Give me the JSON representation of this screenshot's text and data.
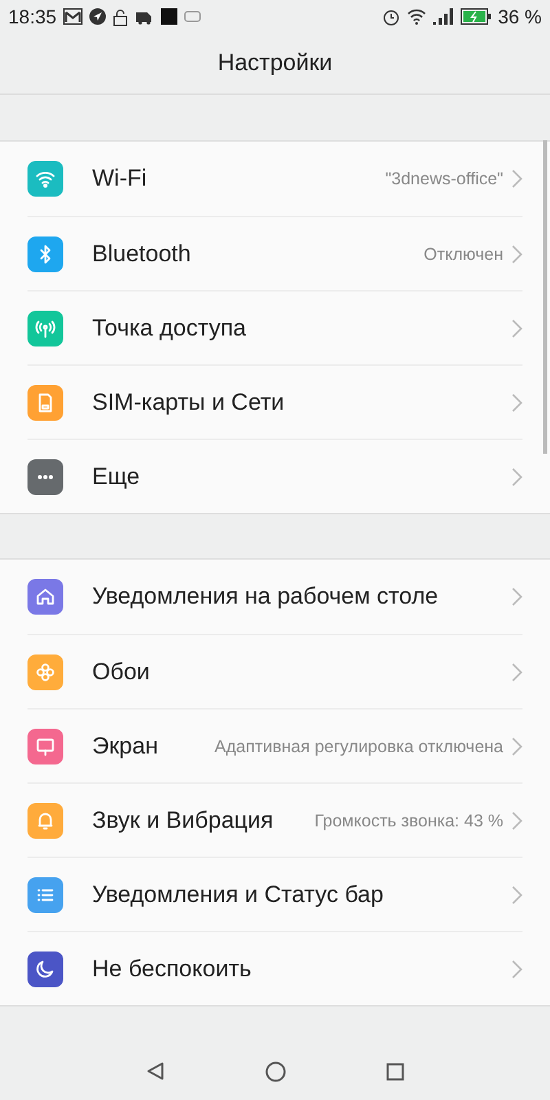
{
  "status_bar": {
    "time": "18:35",
    "battery": "36 %"
  },
  "header": {
    "title": "Настройки"
  },
  "groups": [
    {
      "items": [
        {
          "label": "Wi-Fi",
          "value": "\"3dnews-office\"",
          "color": "#1bbcc0"
        },
        {
          "label": "Bluetooth",
          "value": "Отключен",
          "color": "#1ea7ef"
        },
        {
          "label": "Точка доступа",
          "color": "#12c69a"
        },
        {
          "label": "SIM-карты и Сети",
          "color": "#ffa133"
        },
        {
          "label": "Еще",
          "color": "#666a6d"
        }
      ]
    },
    {
      "items": [
        {
          "label": "Уведомления на рабочем столе",
          "color": "#7a78e6"
        },
        {
          "label": "Обои",
          "color": "#ffac3b"
        },
        {
          "label": "Экран",
          "value": "Адаптивная регулировка отключена",
          "color": "#f4688f"
        },
        {
          "label": "Звук и Вибрация",
          "value": "Громкость звонка: 43 %",
          "color": "#ffab3c"
        },
        {
          "label": "Уведомления и Статус бар",
          "color": "#46a2ef"
        },
        {
          "label": "Не беспокоить",
          "color": "#4b55c6"
        }
      ]
    }
  ]
}
